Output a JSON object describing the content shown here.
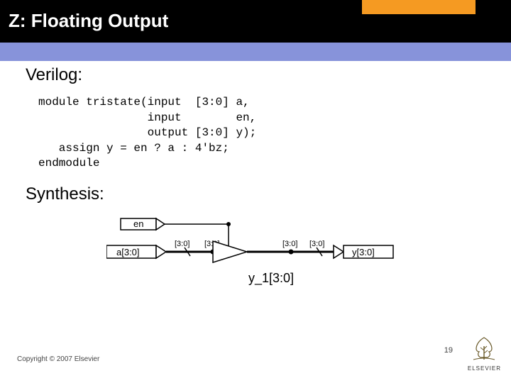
{
  "header": {
    "title": "Z: Floating Output"
  },
  "sections": {
    "verilog_label": "Verilog:",
    "synthesis_label": "Synthesis:"
  },
  "code": {
    "line1": "module tristate(input  [3:0] a,",
    "line2": "                input        en,",
    "line3": "                output [3:0] y);",
    "line4": "   assign y = en ? a : 4'bz;",
    "line5": "endmodule"
  },
  "diagram": {
    "en_label": "en",
    "a_label": "a[3:0]",
    "bus1": "[3:0]",
    "bus2": "[3:0]",
    "bus3": "[3:0]",
    "bus4": "[3:0]",
    "y_label": "y[3:0]",
    "inst_label": "y_1[3:0]"
  },
  "footer": {
    "copyright": "Copyright © 2007 Elsevier",
    "page": "19",
    "brand": "ELSEVIER"
  }
}
